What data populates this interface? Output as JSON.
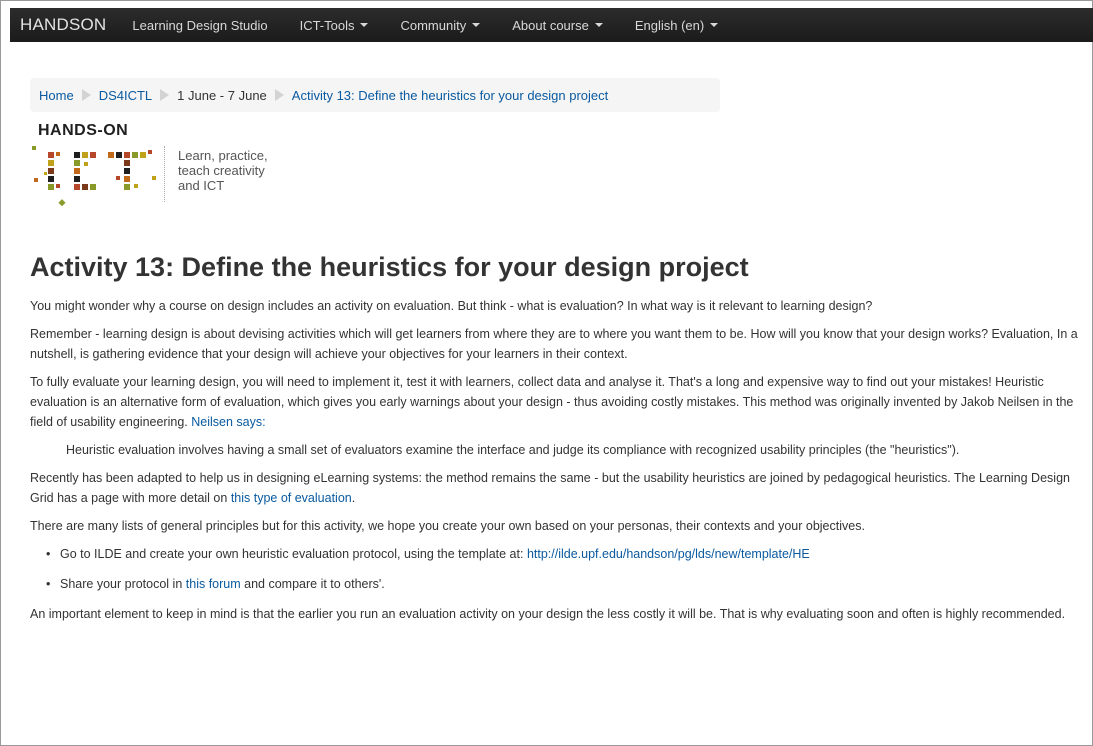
{
  "navbar": {
    "brand": "HANDSON",
    "items": [
      {
        "label": "Learning Design Studio",
        "dropdown": false
      },
      {
        "label": "ICT-Tools",
        "dropdown": true
      },
      {
        "label": "Community",
        "dropdown": true
      },
      {
        "label": "About course",
        "dropdown": true
      },
      {
        "label": "English (en)",
        "dropdown": true
      }
    ]
  },
  "breadcrumb": {
    "items": [
      "Home",
      "DS4ICTL",
      "1 June - 7 June",
      "Activity 13: Define the heuristics for your design project"
    ]
  },
  "logo": {
    "title": "HANDS-ON",
    "mark_text": "ICT",
    "tagline": "Learn, practice, teach creativity and ICT"
  },
  "page": {
    "title": "Activity 13: Define the heuristics for your design project",
    "p1": "You might wonder why a course on design includes an activity on evaluation. But think - what is evaluation? In what way is it relevant to learning design?",
    "p2": "Remember - learning design is about devising activities which will get learners from where they are to where you want them to be. How will you know that your design works? Evaluation, In a nutshell, is gathering evidence that your design will achieve your objectives for your learners in their context.",
    "p3_text": "To fully evaluate your learning design, you will need to implement it, test it with learners, collect data and analyse it. That's a long and expensive way to find out your mistakes! Heuristic evaluation is an alternative form of evaluation, which gives you early warnings about your design - thus avoiding costly mistakes. This method was originally invented by Jakob Neilsen in the field of usability engineering. ",
    "p3_link": "Neilsen says:",
    "quote": "Heuristic evaluation involves having a small set of evaluators examine the interface and judge its compliance with recognized usability principles (the \"heuristics\").",
    "p4_text": "Recently has been adapted to help us in designing eLearning systems: the method remains the same - but the usability heuristics are joined by pedagogical heuristics. The Learning Design Grid has a page with more detail on ",
    "p4_link": "this type of evaluation",
    "p4_end": ".",
    "p5": "There are many lists of general principles but for this activity, we hope you create your own based on your personas, their contexts and your objectives.",
    "bullet1_text": "Go to ILDE and create your own heuristic evaluation protocol, using the template at: ",
    "bullet1_link": "http://ilde.upf.edu/handson/pg/lds/new/template/HE",
    "bullet2_text": "Share your protocol in ",
    "bullet2_link": "this forum",
    "bullet2_end": " and compare it to others'.",
    "p6": "An important element to keep in mind is that the earlier you run an evaluation activity on your design the less costly it will be. That is why evaluating soon and often is highly recommended."
  },
  "colors": {
    "navbar_bg": "#1f1f1f",
    "link": "#0a5aa0",
    "breadcrumb_bg": "#f5f5f5"
  }
}
